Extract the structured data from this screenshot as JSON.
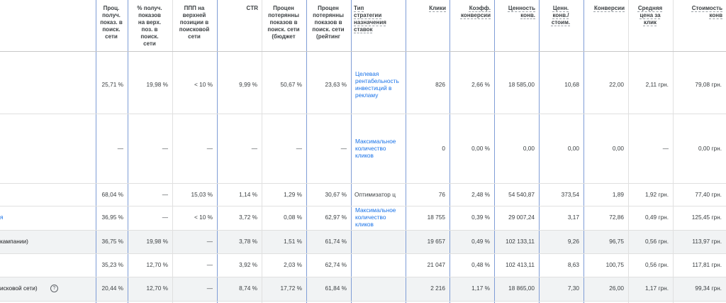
{
  "columns": [
    {
      "id": "impr_share",
      "label": "Проц.\nполуч.\nпоказ. в\nпоиск.\nсети"
    },
    {
      "id": "top_impr",
      "label": "% получ.\nпоказов\nна верх.\nпоз. в\nпоиск.\nсети"
    },
    {
      "id": "top_pos",
      "label": "ППП на\nверхней\nпозиции в\nпоисковой\nсети"
    },
    {
      "id": "ctr",
      "label": "CTR"
    },
    {
      "id": "lost_budget",
      "label": "Процен\nпотерянны\nпоказов в\nпоиск. сети\n(бюджет"
    },
    {
      "id": "lost_rank",
      "label": "Процен\nпотерянны\nпоказов в\nпоиск. сети\n(рейтинг"
    },
    {
      "id": "bid_strategy",
      "label": "Тип\nстратегии\nназначения\nставок"
    },
    {
      "id": "clicks",
      "label": "Клики"
    },
    {
      "id": "conv_rate",
      "label": "Коэфф.\nконверсии"
    },
    {
      "id": "conv_value",
      "label": "Ценность\nконв."
    },
    {
      "id": "value_cost",
      "label": "Ценн.\nконв./\nстоим."
    },
    {
      "id": "conversions",
      "label": "Конверсии"
    },
    {
      "id": "avg_cpc",
      "label": "Средняя\nцена за\nклик"
    },
    {
      "id": "cost_conv",
      "label": "Стоимость\nконв"
    }
  ],
  "rows": [
    {
      "label": "",
      "cells": [
        "25,71 %",
        "19,98 %",
        "< 10 %",
        "9,99 %",
        "50,67 %",
        "23,63 %",
        "",
        "826",
        "2,66 %",
        "18 585,00",
        "10,68",
        "22,00",
        "2,11 грн.",
        "79,08 грн."
      ],
      "strategy_link": "Целевая\nрентабельность\nинвестиций в\nрекламу"
    },
    {
      "label": "",
      "cells": [
        "—",
        "—",
        "—",
        "—",
        "—",
        "—",
        "",
        "0",
        "0,00 %",
        "0,00",
        "0,00",
        "0,00",
        "—",
        "0,00 грн."
      ],
      "strategy_link": "Максимальное\nколичество\nкликов"
    },
    {
      "label": "",
      "cells": [
        "68,04 %",
        "—",
        "15,03 %",
        "1,14 %",
        "1,29 %",
        "30,67 %",
        "Оптимизатор ц",
        "76",
        "2,48 %",
        "54 540,87",
        "373,54",
        "1,89",
        "1,92 грн.",
        "77,40 грн."
      ],
      "strategy_link": ""
    },
    {
      "label": "я",
      "cells": [
        "36,95 %",
        "—",
        "< 10 %",
        "3,72 %",
        "0,08 %",
        "62,97 %",
        "",
        "18 755",
        "0,39 %",
        "29 007,24",
        "3,17",
        "72,86",
        "0,49 грн.",
        "125,45 грн."
      ],
      "strategy_link": "Максимальное\nколичество\nкликов"
    },
    {
      "label": "кампании)",
      "cells": [
        "36,75 %",
        "19,98 %",
        "—",
        "3,78 %",
        "1,51 %",
        "61,74 %",
        "",
        "19 657",
        "0,49 %",
        "102 133,11",
        "9,26",
        "96,75",
        "0,56 грн.",
        "113,97 грн."
      ],
      "strategy_link": ""
    },
    {
      "label": "",
      "cells": [
        "35,23 %",
        "12,70 %",
        "—",
        "3,92 %",
        "2,03 %",
        "62,74 %",
        "",
        "21 047",
        "0,48 %",
        "102 413,11",
        "8,63",
        "100,75",
        "0,56 грн.",
        "117,81 грн."
      ],
      "strategy_link": ""
    },
    {
      "label": "исковой сети)",
      "help_icon": "?",
      "cells": [
        "20,44 %",
        "12,70 %",
        "—",
        "8,74 %",
        "17,72 %",
        "61,84 %",
        "",
        "2 216",
        "1,17 %",
        "18 865,00",
        "7,30",
        "26,00",
        "1,17 грн.",
        "99,34 грн."
      ],
      "strategy_link": ""
    }
  ]
}
